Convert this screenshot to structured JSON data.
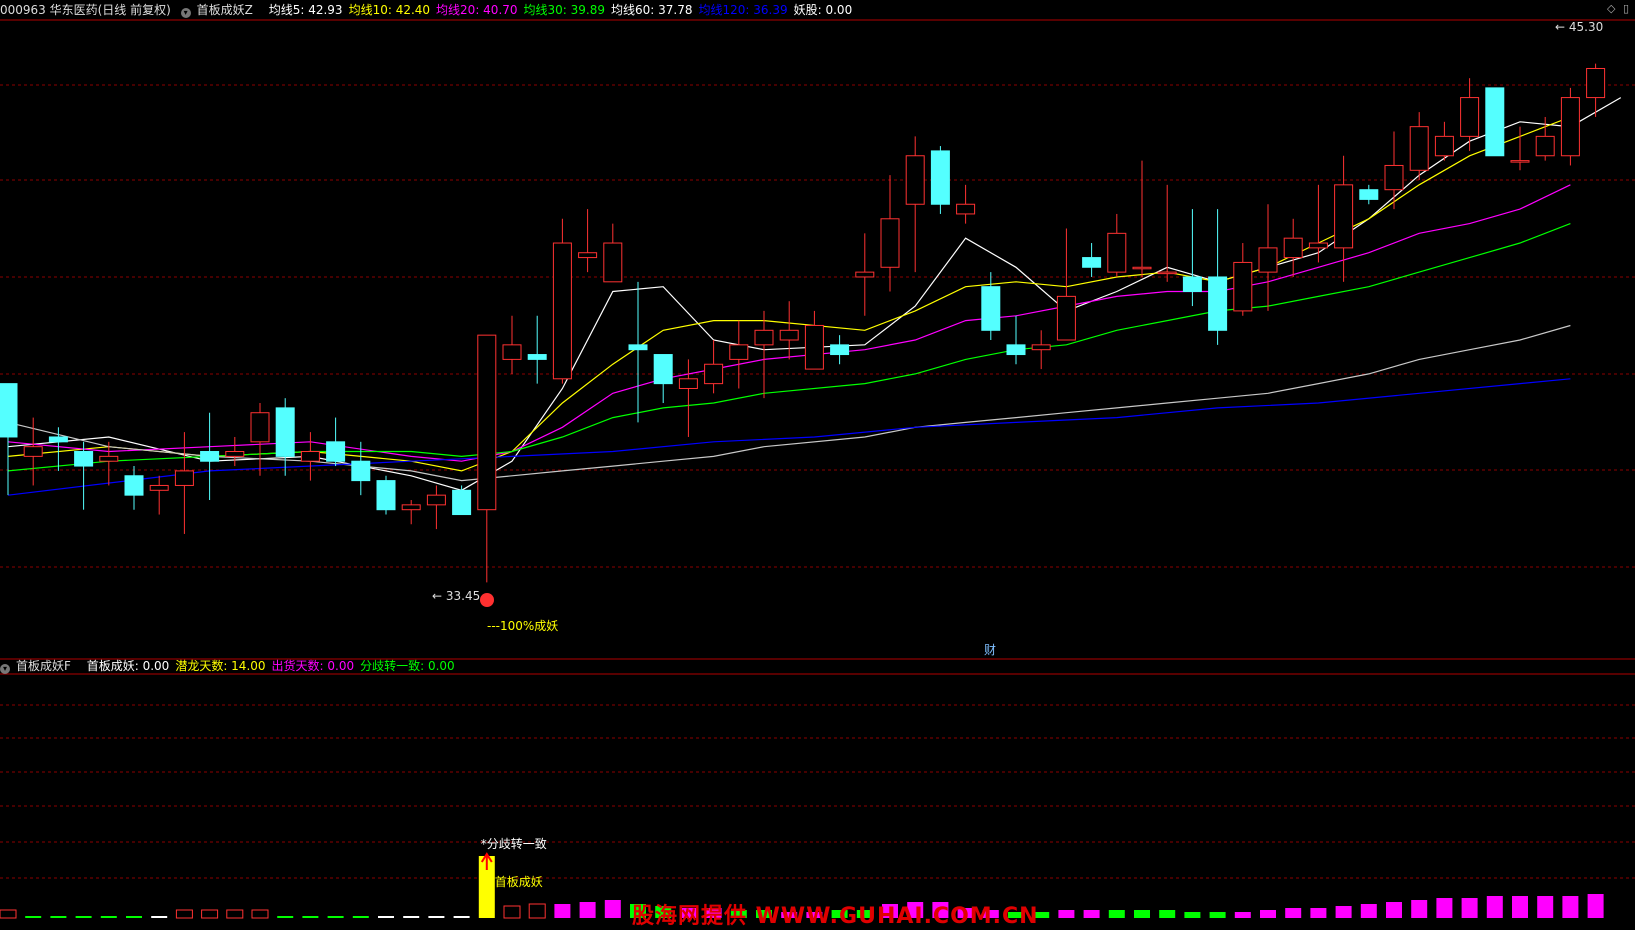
{
  "top_header": {
    "stock": "000963 华东医药(日线 前复权)",
    "indicator": "首板成妖Z",
    "items": [
      {
        "label": "均线5: 42.93",
        "color": "#ffffff"
      },
      {
        "label": "均线10: 42.40",
        "color": "#ffff00"
      },
      {
        "label": "均线20: 40.70",
        "color": "#ff00ff"
      },
      {
        "label": "均线30: 39.89",
        "color": "#00ff00"
      },
      {
        "label": "均线60: 37.78",
        "color": "#ffffff"
      },
      {
        "label": "均线120: 36.39",
        "color": "#0000ff"
      },
      {
        "label": "妖股: 0.00",
        "color": "#ffffff"
      }
    ]
  },
  "bottom_header": {
    "indicator": "首板成妖F",
    "items": [
      {
        "label": "首板成妖: 0.00",
        "color": "#ffffff"
      },
      {
        "label": "潜龙天数: 14.00",
        "color": "#ffff00"
      },
      {
        "label": "出货天数: 0.00",
        "color": "#ff00ff"
      },
      {
        "label": "分歧转一致: 0.00",
        "color": "#00ff00"
      }
    ]
  },
  "annotations": {
    "high_price": "45.30",
    "low_price": "33.45",
    "signal_main": "---100%成妖",
    "finance_mark": "财",
    "signal_sub_top": "*分歧转一致",
    "signal_sub_label": "首板成妖"
  },
  "watermark": "股海网提供 WWW.GUHAI.COM.CN",
  "colors": {
    "up": "#ff3232",
    "down": "#54ffff",
    "grid": "#8b0000",
    "ma5": "#ffffff",
    "ma10": "#ffff00",
    "ma20": "#ff00ff",
    "ma30": "#00ff00",
    "ma60": "#c8c8c8",
    "ma120": "#0000ff",
    "bar_magenta": "#ff00ff",
    "bar_green": "#00ff00",
    "bar_yellow": "#ffff00"
  },
  "chart_data": {
    "type": "candlestick",
    "ylim": [
      33.0,
      46.2
    ],
    "grid": true,
    "candles": [
      [
        38.7,
        37.6,
        36.4,
        37.8
      ],
      [
        37.2,
        37.4,
        36.6,
        38.0
      ],
      [
        37.6,
        37.5,
        36.9,
        37.8
      ],
      [
        37.3,
        37.0,
        36.1,
        37.5
      ],
      [
        37.1,
        37.2,
        36.6,
        37.5
      ],
      [
        36.8,
        36.4,
        36.1,
        37.0
      ],
      [
        36.5,
        36.6,
        36.0,
        36.8
      ],
      [
        36.6,
        36.9,
        35.6,
        37.7
      ],
      [
        37.3,
        37.1,
        36.3,
        38.1
      ],
      [
        37.2,
        37.3,
        37.0,
        37.6
      ],
      [
        37.5,
        38.1,
        36.8,
        38.3
      ],
      [
        38.2,
        37.2,
        36.8,
        38.4
      ],
      [
        37.1,
        37.3,
        36.7,
        37.7
      ],
      [
        37.5,
        37.1,
        37.0,
        38.0
      ],
      [
        37.1,
        36.7,
        36.4,
        37.5
      ],
      [
        36.7,
        36.1,
        36.0,
        36.8
      ],
      [
        36.1,
        36.2,
        35.8,
        36.3
      ],
      [
        36.2,
        36.4,
        35.7,
        36.6
      ],
      [
        36.5,
        36.0,
        36.3,
        36.6
      ],
      [
        36.1,
        39.7,
        34.6,
        39.7
      ],
      [
        39.2,
        39.5,
        38.9,
        40.1
      ],
      [
        39.3,
        39.2,
        38.7,
        40.1
      ],
      [
        38.8,
        41.6,
        38.7,
        42.1
      ],
      [
        41.3,
        41.4,
        41.0,
        42.3
      ],
      [
        40.8,
        41.6,
        40.8,
        42.0
      ],
      [
        39.5,
        39.4,
        37.9,
        40.8
      ],
      [
        39.3,
        38.7,
        38.3,
        39.3
      ],
      [
        38.6,
        38.8,
        37.6,
        39.2
      ],
      [
        38.7,
        39.1,
        38.5,
        39.6
      ],
      [
        39.2,
        39.5,
        38.6,
        40.0
      ],
      [
        39.5,
        39.8,
        38.4,
        40.2
      ],
      [
        39.6,
        39.8,
        39.2,
        40.4
      ],
      [
        39.0,
        39.9,
        39.0,
        40.2
      ],
      [
        39.5,
        39.3,
        39.1,
        39.7
      ],
      [
        40.9,
        41.0,
        40.1,
        41.8
      ],
      [
        41.1,
        42.1,
        40.6,
        43.0
      ],
      [
        42.4,
        43.4,
        41.0,
        43.8
      ],
      [
        43.5,
        42.4,
        42.2,
        43.6
      ],
      [
        42.2,
        42.4,
        42.0,
        42.8
      ],
      [
        40.7,
        39.8,
        39.6,
        41.0
      ],
      [
        39.5,
        39.3,
        39.1,
        40.1
      ],
      [
        39.4,
        39.5,
        39.0,
        39.8
      ],
      [
        39.6,
        40.5,
        39.6,
        41.9
      ],
      [
        41.3,
        41.1,
        40.9,
        41.6
      ],
      [
        41.0,
        41.8,
        40.9,
        42.2
      ],
      [
        41.1,
        41.1,
        40.9,
        43.3
      ],
      [
        41.0,
        41.0,
        40.8,
        42.8
      ],
      [
        40.9,
        40.6,
        40.3,
        42.3
      ],
      [
        40.9,
        39.8,
        39.5,
        42.3
      ],
      [
        40.2,
        41.2,
        40.1,
        41.6
      ],
      [
        41.0,
        41.5,
        40.2,
        42.4
      ],
      [
        41.3,
        41.7,
        40.9,
        42.1
      ],
      [
        41.5,
        41.6,
        41.2,
        42.8
      ],
      [
        41.5,
        42.8,
        40.8,
        43.4
      ],
      [
        42.7,
        42.5,
        42.4,
        42.8
      ],
      [
        42.7,
        43.2,
        42.3,
        43.9
      ],
      [
        43.1,
        44.0,
        42.9,
        44.3
      ],
      [
        43.4,
        43.8,
        43.3,
        44.1
      ],
      [
        43.8,
        44.6,
        43.5,
        45.0
      ],
      [
        44.8,
        43.4,
        43.4,
        44.8
      ],
      [
        43.3,
        43.3,
        43.1,
        44.0
      ],
      [
        43.4,
        43.8,
        43.3,
        44.2
      ],
      [
        43.4,
        44.6,
        43.2,
        44.8
      ],
      [
        44.6,
        45.2,
        44.2,
        45.3
      ]
    ],
    "series": [
      {
        "name": "均线5",
        "values": [
          [
            0,
            37.4
          ],
          [
            4,
            37.6
          ],
          [
            8,
            37.1
          ],
          [
            12,
            37.2
          ],
          [
            16,
            36.8
          ],
          [
            18,
            36.5
          ],
          [
            20,
            37.1
          ],
          [
            22,
            38.6
          ],
          [
            24,
            40.6
          ],
          [
            26,
            40.7
          ],
          [
            28,
            39.6
          ],
          [
            30,
            39.4
          ],
          [
            34,
            39.5
          ],
          [
            36,
            40.3
          ],
          [
            38,
            41.7
          ],
          [
            40,
            41.1
          ],
          [
            42,
            40.2
          ],
          [
            44,
            40.6
          ],
          [
            46,
            41.1
          ],
          [
            48,
            40.8
          ],
          [
            50,
            41.1
          ],
          [
            52,
            41.4
          ],
          [
            54,
            42.1
          ],
          [
            56,
            43.0
          ],
          [
            58,
            43.7
          ],
          [
            60,
            44.1
          ],
          [
            62,
            44.0
          ],
          [
            64,
            44.6
          ]
        ]
      },
      {
        "name": "均线10",
        "values": [
          [
            0,
            37.2
          ],
          [
            4,
            37.4
          ],
          [
            8,
            37.2
          ],
          [
            12,
            37.3
          ],
          [
            16,
            37.1
          ],
          [
            18,
            36.9
          ],
          [
            20,
            37.3
          ],
          [
            22,
            38.3
          ],
          [
            24,
            39.1
          ],
          [
            26,
            39.8
          ],
          [
            28,
            40.0
          ],
          [
            30,
            40.0
          ],
          [
            34,
            39.8
          ],
          [
            36,
            40.2
          ],
          [
            38,
            40.7
          ],
          [
            40,
            40.8
          ],
          [
            42,
            40.7
          ],
          [
            44,
            40.9
          ],
          [
            46,
            41.0
          ],
          [
            48,
            40.8
          ],
          [
            50,
            41.1
          ],
          [
            52,
            41.6
          ],
          [
            54,
            42.1
          ],
          [
            56,
            42.8
          ],
          [
            58,
            43.4
          ],
          [
            60,
            43.8
          ],
          [
            62,
            44.2
          ]
        ]
      },
      {
        "name": "均线20",
        "values": [
          [
            0,
            37.5
          ],
          [
            4,
            37.3
          ],
          [
            8,
            37.4
          ],
          [
            12,
            37.5
          ],
          [
            16,
            37.2
          ],
          [
            18,
            37.1
          ],
          [
            20,
            37.3
          ],
          [
            22,
            37.8
          ],
          [
            24,
            38.5
          ],
          [
            26,
            38.8
          ],
          [
            28,
            39.0
          ],
          [
            30,
            39.2
          ],
          [
            34,
            39.4
          ],
          [
            36,
            39.6
          ],
          [
            38,
            40.0
          ],
          [
            40,
            40.1
          ],
          [
            42,
            40.3
          ],
          [
            44,
            40.5
          ],
          [
            46,
            40.6
          ],
          [
            48,
            40.6
          ],
          [
            50,
            40.8
          ],
          [
            52,
            41.1
          ],
          [
            54,
            41.4
          ],
          [
            56,
            41.8
          ],
          [
            58,
            42.0
          ],
          [
            60,
            42.3
          ],
          [
            62,
            42.8
          ]
        ]
      },
      {
        "name": "均线30",
        "values": [
          [
            0,
            36.9
          ],
          [
            4,
            37.1
          ],
          [
            8,
            37.2
          ],
          [
            12,
            37.3
          ],
          [
            16,
            37.3
          ],
          [
            18,
            37.2
          ],
          [
            20,
            37.3
          ],
          [
            22,
            37.6
          ],
          [
            24,
            38.0
          ],
          [
            26,
            38.2
          ],
          [
            28,
            38.3
          ],
          [
            30,
            38.5
          ],
          [
            34,
            38.7
          ],
          [
            36,
            38.9
          ],
          [
            38,
            39.2
          ],
          [
            40,
            39.4
          ],
          [
            42,
            39.5
          ],
          [
            44,
            39.8
          ],
          [
            46,
            40.0
          ],
          [
            48,
            40.2
          ],
          [
            50,
            40.3
          ],
          [
            52,
            40.5
          ],
          [
            54,
            40.7
          ],
          [
            56,
            41.0
          ],
          [
            58,
            41.3
          ],
          [
            60,
            41.6
          ],
          [
            62,
            42.0
          ]
        ]
      },
      {
        "name": "均线60",
        "values": [
          [
            0,
            37.9
          ],
          [
            4,
            37.4
          ],
          [
            8,
            37.2
          ],
          [
            12,
            37.1
          ],
          [
            16,
            36.9
          ],
          [
            18,
            36.7
          ],
          [
            20,
            36.8
          ],
          [
            22,
            36.9
          ],
          [
            24,
            37.0
          ],
          [
            26,
            37.1
          ],
          [
            28,
            37.2
          ],
          [
            30,
            37.4
          ],
          [
            34,
            37.6
          ],
          [
            36,
            37.8
          ],
          [
            38,
            37.9
          ],
          [
            40,
            38.0
          ],
          [
            42,
            38.1
          ],
          [
            44,
            38.2
          ],
          [
            46,
            38.3
          ],
          [
            48,
            38.4
          ],
          [
            50,
            38.5
          ],
          [
            52,
            38.7
          ],
          [
            54,
            38.9
          ],
          [
            56,
            39.2
          ],
          [
            58,
            39.4
          ],
          [
            60,
            39.6
          ],
          [
            62,
            39.9
          ]
        ]
      },
      {
        "name": "均线120",
        "values": [
          [
            0,
            36.4
          ],
          [
            8,
            36.9
          ],
          [
            16,
            37.1
          ],
          [
            20,
            37.2
          ],
          [
            24,
            37.3
          ],
          [
            28,
            37.5
          ],
          [
            32,
            37.6
          ],
          [
            36,
            37.8
          ],
          [
            40,
            37.9
          ],
          [
            44,
            38.0
          ],
          [
            48,
            38.2
          ],
          [
            52,
            38.3
          ],
          [
            56,
            38.5
          ],
          [
            60,
            38.7
          ],
          [
            62,
            38.8
          ]
        ]
      }
    ],
    "sub_bars": [
      {
        "h": 2,
        "c": "up"
      },
      {
        "h": 2,
        "c": "g"
      },
      {
        "h": 2,
        "c": "g"
      },
      {
        "h": 2,
        "c": "g"
      },
      {
        "h": 2,
        "c": "g"
      },
      {
        "h": 2,
        "c": "g"
      },
      {
        "h": 2,
        "c": "w"
      },
      {
        "h": 2,
        "c": "up"
      },
      {
        "h": 2,
        "c": "up"
      },
      {
        "h": 2,
        "c": "up"
      },
      {
        "h": 2,
        "c": "up"
      },
      {
        "h": 2,
        "c": "g"
      },
      {
        "h": 2,
        "c": "g"
      },
      {
        "h": 2,
        "c": "g"
      },
      {
        "h": 2,
        "c": "g"
      },
      {
        "h": 2,
        "c": "w"
      },
      {
        "h": 2,
        "c": "w"
      },
      {
        "h": 2,
        "c": "w"
      },
      {
        "h": 2,
        "c": "w"
      },
      {
        "h": 62,
        "c": "y"
      },
      {
        "h": 6,
        "c": "up"
      },
      {
        "h": 8,
        "c": "up"
      },
      {
        "h": 14,
        "c": "m"
      },
      {
        "h": 16,
        "c": "m"
      },
      {
        "h": 18,
        "c": "m"
      },
      {
        "h": 14,
        "c": "g"
      },
      {
        "h": 12,
        "c": "g"
      },
      {
        "h": 10,
        "c": "m"
      },
      {
        "h": 10,
        "c": "m"
      },
      {
        "h": 8,
        "c": "g"
      },
      {
        "h": 8,
        "c": "g"
      },
      {
        "h": 6,
        "c": "m"
      },
      {
        "h": 6,
        "c": "m"
      },
      {
        "h": 8,
        "c": "g"
      },
      {
        "h": 8,
        "c": "g"
      },
      {
        "h": 14,
        "c": "m"
      },
      {
        "h": 16,
        "c": "m"
      },
      {
        "h": 16,
        "c": "m"
      },
      {
        "h": 10,
        "c": "m"
      },
      {
        "h": 8,
        "c": "m"
      },
      {
        "h": 6,
        "c": "g"
      },
      {
        "h": 6,
        "c": "g"
      },
      {
        "h": 8,
        "c": "m"
      },
      {
        "h": 8,
        "c": "m"
      },
      {
        "h": 8,
        "c": "g"
      },
      {
        "h": 8,
        "c": "g"
      },
      {
        "h": 8,
        "c": "g"
      },
      {
        "h": 6,
        "c": "g"
      },
      {
        "h": 6,
        "c": "g"
      },
      {
        "h": 6,
        "c": "m"
      },
      {
        "h": 8,
        "c": "m"
      },
      {
        "h": 10,
        "c": "m"
      },
      {
        "h": 10,
        "c": "m"
      },
      {
        "h": 12,
        "c": "m"
      },
      {
        "h": 14,
        "c": "m"
      },
      {
        "h": 16,
        "c": "m"
      },
      {
        "h": 18,
        "c": "m"
      },
      {
        "h": 20,
        "c": "m"
      },
      {
        "h": 20,
        "c": "m"
      },
      {
        "h": 22,
        "c": "m"
      },
      {
        "h": 22,
        "c": "m"
      },
      {
        "h": 22,
        "c": "m"
      },
      {
        "h": 22,
        "c": "m"
      },
      {
        "h": 24,
        "c": "m"
      }
    ]
  }
}
